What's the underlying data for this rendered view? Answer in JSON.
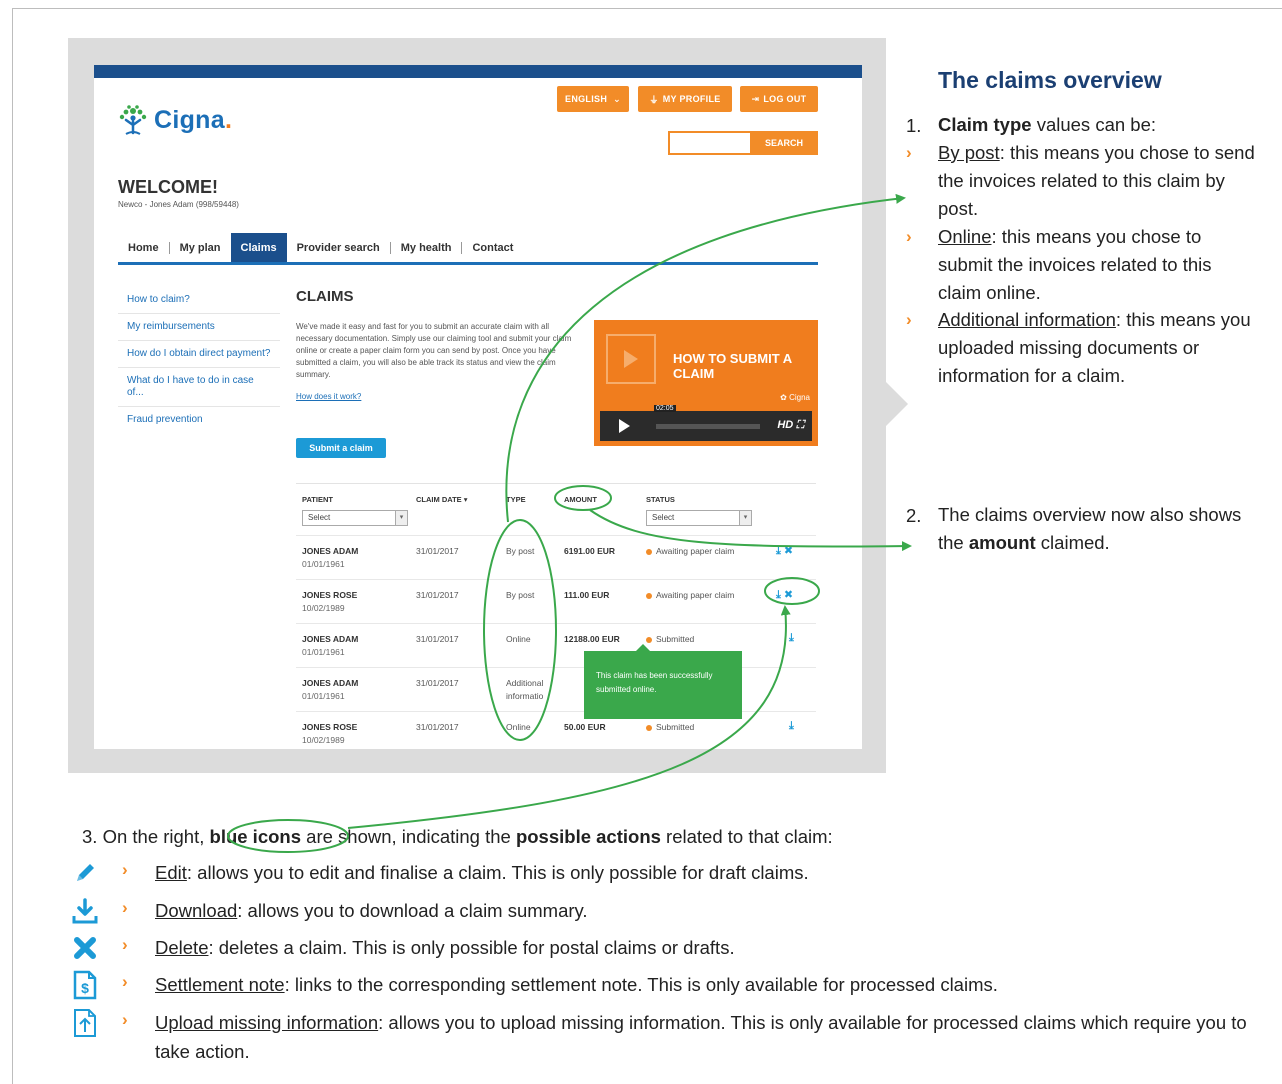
{
  "site": {
    "brand": "Cigna",
    "lang_button": "ENGLISH",
    "profile_button": "MY PROFILE",
    "logout_button": "LOG OUT",
    "search_button": "SEARCH",
    "welcome": "WELCOME!",
    "welcome_sub": "Newco - Jones Adam (998/59448)",
    "nav": [
      "Home",
      "My plan",
      "Claims",
      "Provider search",
      "My health",
      "Contact"
    ],
    "sidebar": [
      "How to claim?",
      "My reimbursements",
      "How do I obtain direct payment?",
      "What do I have to do in case of...",
      "Fraud prevention"
    ],
    "claims_title": "CLAIMS",
    "claims_desc": "We've made it easy and fast for you to submit an accurate claim with all necessary documentation. Simply use our claiming tool and submit your claim online or create a paper claim form you can send by post. Once you have submitted a claim, you will also be able track its status and view the claim summary.",
    "claims_link": "How does it work?",
    "submit_button": "Submit a claim",
    "video": {
      "title": "HOW TO SUBMIT A CLAIM",
      "brand": "Cigna",
      "time": "02:05",
      "hd": "HD"
    },
    "table": {
      "headers": {
        "patient": "PATIENT",
        "claim_date": "CLAIM DATE",
        "type": "TYPE",
        "amount": "AMOUNT",
        "status": "STATUS"
      },
      "select_placeholder": "Select",
      "rows": [
        {
          "name": "JONES ADAM",
          "dob": "01/01/1961",
          "date": "31/01/2017",
          "type": "By post",
          "amount": "6191.00 EUR",
          "status": "Awaiting paper claim",
          "actions": "⤓ ✖"
        },
        {
          "name": "JONES ROSE",
          "dob": "10/02/1989",
          "date": "31/01/2017",
          "type": "By post",
          "amount": "111.00 EUR",
          "status": "Awaiting paper claim",
          "actions": "⤓ ✖"
        },
        {
          "name": "JONES ADAM",
          "dob": "01/01/1961",
          "date": "31/01/2017",
          "type": "Online",
          "amount": "12188.00 EUR",
          "status": "Submitted",
          "actions": "⤓"
        },
        {
          "name": "JONES ADAM",
          "dob": "01/01/1961",
          "date": "31/01/2017",
          "type": "Additional informatio",
          "amount": "",
          "status": "",
          "actions": ""
        },
        {
          "name": "JONES ROSE",
          "dob": "10/02/1989",
          "date": "31/01/2017",
          "type": "Online",
          "amount": "50.00 EUR",
          "status": "Submitted",
          "actions": "⤓"
        }
      ]
    },
    "tooltip": "This claim has been successfully submitted online."
  },
  "guide": {
    "title": "The claims overview",
    "item1_num": "1.",
    "item1_bold": "Claim type",
    "item1_rest": " values can be:",
    "bullets": [
      {
        "term": "By post",
        "text": ": this means you chose to send the invoices related to this claim by post."
      },
      {
        "term": "Online",
        "text": ": this means you chose to submit the invoices related to this claim online."
      },
      {
        "term": "Additional information",
        "text": ": this means you uploaded missing documents or information for a claim."
      }
    ],
    "item2_num": "2.",
    "item2_a": "The claims overview now also shows the ",
    "item2_bold": "amount",
    "item2_b": " claimed.",
    "item3_a": "3.  On the right, ",
    "item3_bold1": "blue icons",
    "item3_b": " are shown, indicating the ",
    "item3_bold2": "possible actions",
    "item3_c": " related to that claim:",
    "actions": [
      {
        "icon": "pencil-icon",
        "term": "Edit",
        "text": ": allows you to edit and finalise a claim. This is only possible for draft claims."
      },
      {
        "icon": "download-icon",
        "term": "Download",
        "text": ": allows you to download a claim summary."
      },
      {
        "icon": "delete-x-icon",
        "term": "Delete",
        "text": ": deletes a claim. This is only possible for postal claims or drafts."
      },
      {
        "icon": "settlement-note-icon",
        "term": "Settlement note",
        "text": ": links to the corresponding settlement note. This is only available for processed claims."
      },
      {
        "icon": "upload-missing-info-icon",
        "term": "Upload missing information",
        "text": ": allows you to upload missing information. This is only available for processed claims which require you to take action."
      }
    ]
  },
  "colors": {
    "navy": "#1b4f8c",
    "orange": "#f28c28",
    "annotation_green": "#3aa84b",
    "icon_blue": "#1c9ad6",
    "title_navy": "#1b3f72"
  }
}
